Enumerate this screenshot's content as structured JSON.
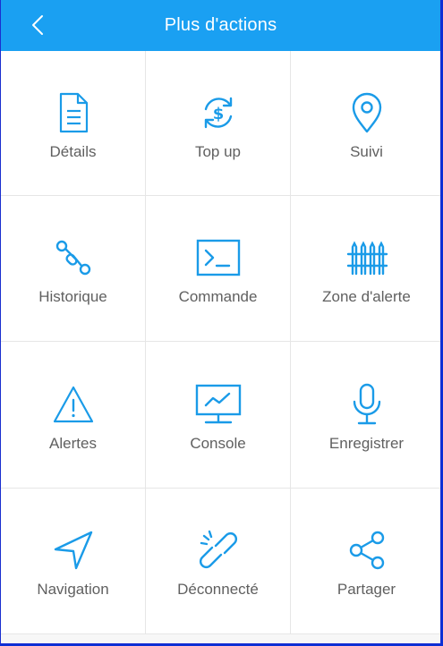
{
  "header": {
    "title": "Plus d'actions",
    "back_icon": "chevron-left-icon"
  },
  "colors": {
    "accent": "#1aa0f2",
    "icon": "#1a9be8",
    "label": "#606060"
  },
  "actions": [
    {
      "label": "Détails",
      "icon": "document-icon"
    },
    {
      "label": "Top up",
      "icon": "dollar-refresh-icon"
    },
    {
      "label": "Suivi",
      "icon": "location-pin-icon"
    },
    {
      "label": "Historique",
      "icon": "route-icon"
    },
    {
      "label": "Commande",
      "icon": "terminal-icon"
    },
    {
      "label": "Zone d'alerte",
      "icon": "fence-icon"
    },
    {
      "label": "Alertes",
      "icon": "warning-icon"
    },
    {
      "label": "Console",
      "icon": "monitor-chart-icon"
    },
    {
      "label": "Enregistrer",
      "icon": "microphone-icon"
    },
    {
      "label": "Navigation",
      "icon": "navigation-arrow-icon"
    },
    {
      "label": "Déconnecté",
      "icon": "broken-link-icon"
    },
    {
      "label": "Partager",
      "icon": "share-icon"
    }
  ]
}
